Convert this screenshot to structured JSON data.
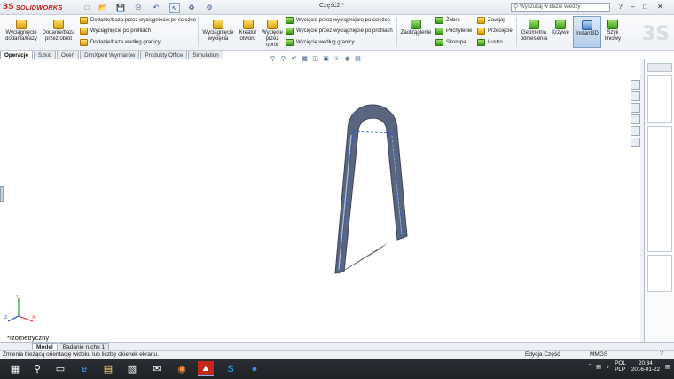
{
  "app": {
    "brand_ds": "3S",
    "brand_name": "SOLIDWORKS",
    "document_title": "Część2 *"
  },
  "search": {
    "placeholder": "Wyszukaj w Bazie wiedzy"
  },
  "ribbon": {
    "big_buttons": [
      {
        "label1": "Wyciągnięcie",
        "label2": "dodania/bazy",
        "icon": "extrude-boss-icon"
      },
      {
        "label1": "Dodanie/baza",
        "label2": "przez obrót",
        "icon": "revolve-boss-icon"
      },
      {
        "label1": "Wyciągnięcie",
        "label2": "wycięcia",
        "icon": "extrude-cut-icon"
      },
      {
        "label1": "Kreator",
        "label2": "otworu",
        "icon": "hole-wizard-icon"
      },
      {
        "label1": "Wycięcie",
        "label2": "przez obrót",
        "icon": "revolve-cut-icon"
      },
      {
        "label1": "Zaokrąglenie",
        "label2": "",
        "icon": "fillet-icon"
      },
      {
        "label1": "Geometria",
        "label2": "odniesienia",
        "icon": "reference-geometry-icon"
      },
      {
        "label1": "Krzywe",
        "label2": "",
        "icon": "curves-icon"
      },
      {
        "label1": "Instant3D",
        "label2": "",
        "icon": "instant3d-icon"
      },
      {
        "label1": "Szyk",
        "label2": "liniowy",
        "icon": "linear-pattern-icon"
      }
    ],
    "boss_list": [
      "Dodanie/baza przez wyciągnięcie po ścieżce",
      "Wyciągnięcie po profilach",
      "Dodanie/baza według granicy"
    ],
    "cut_list": [
      "Wycięcie przez wyciągnięcie po ścieżce",
      "Wycięcie przez wyciągnięcie po profilach",
      "Wycięcie według granicy"
    ],
    "features_col1": [
      "Żebro",
      "Pochylenie",
      "Skorupa"
    ],
    "features_col2": [
      "Zawijaj",
      "Przecięcie",
      "Lustro"
    ]
  },
  "tabs": [
    "Operacje",
    "Szkic",
    "Oceń",
    "DimXpert Wymiarów",
    "Produkty Office",
    "Simulation"
  ],
  "viewport": {
    "view_label": "*Izometryczny",
    "triad_x": "X",
    "triad_y": "Y",
    "triad_z": "Z"
  },
  "bottom_tabs": [
    "Model",
    "Badanie ruchu 1"
  ],
  "status": {
    "message": "Zmienia bieżącą orientację widoku lub liczbę okienek ekranu.",
    "mode": "Edycja Część",
    "units": "MMGS"
  },
  "tray": {
    "lang1": "POL",
    "lang2": "PLP",
    "time": "20:34",
    "date": "2016-01-22"
  },
  "colors": {
    "accent": "#2f5f9b",
    "model_fill": "#5a6680",
    "taskbar": "#24282d"
  }
}
